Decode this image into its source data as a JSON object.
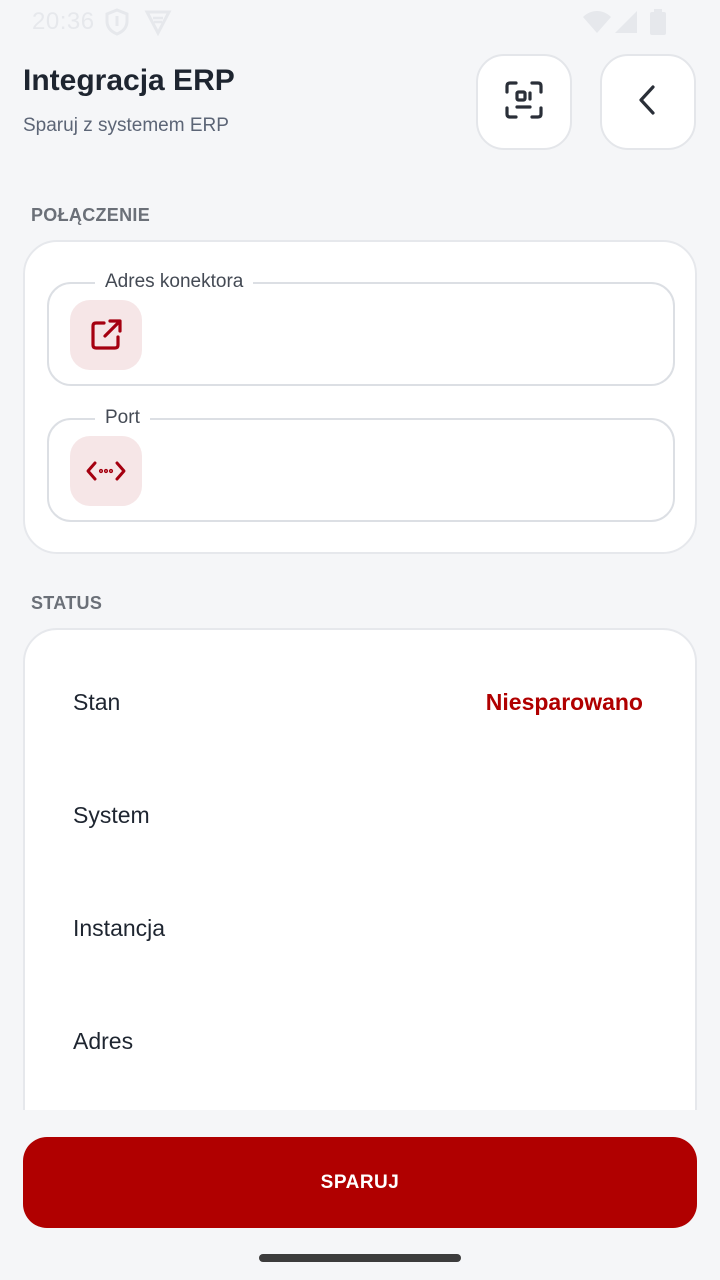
{
  "status_bar": {
    "time": "20:36",
    "icons": [
      "shield-icon",
      "vpn-icon",
      "wifi-icon",
      "signal-icon",
      "battery-icon"
    ]
  },
  "header": {
    "title": "Integracja ERP",
    "subtitle": "Sparuj z systemem ERP",
    "scan_icon": "qr-scan-icon",
    "back_icon": "chevron-left-icon"
  },
  "connection": {
    "section_label": "POŁĄCZENIE",
    "fields": [
      {
        "label": "Adres konektora",
        "value": "",
        "icon": "external-link-icon"
      },
      {
        "label": "Port",
        "value": "",
        "icon": "code-arrows-icon"
      }
    ]
  },
  "status": {
    "section_label": "STATUS",
    "rows": [
      {
        "key": "Stan",
        "value": "Niesparowano"
      },
      {
        "key": "System",
        "value": ""
      },
      {
        "key": "Instancja",
        "value": ""
      },
      {
        "key": "Adres",
        "value": ""
      }
    ]
  },
  "actions": {
    "pair_label": "SPARUJ"
  },
  "colors": {
    "accent": "#b00000",
    "background": "#f5f6f8",
    "icon_bg": "#f6e6e7"
  }
}
